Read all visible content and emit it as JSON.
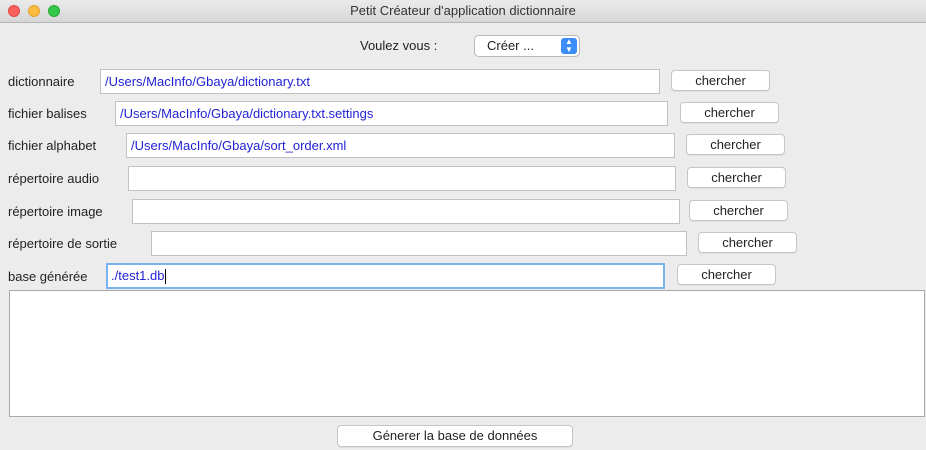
{
  "window": {
    "title": "Petit Créateur d'application dictionnaire"
  },
  "mode": {
    "label": "Voulez vous :",
    "selected": "Créer ..."
  },
  "rows": [
    {
      "label": "dictionnaire",
      "value": "/Users/MacInfo/Gbaya/dictionary.txt",
      "button": "chercher"
    },
    {
      "label": "fichier balises",
      "value": "/Users/MacInfo/Gbaya/dictionary.txt.settings",
      "button": "chercher"
    },
    {
      "label": "fichier alphabet",
      "value": "/Users/MacInfo/Gbaya/sort_order.xml",
      "button": "chercher"
    },
    {
      "label": "répertoire audio",
      "value": "",
      "button": "chercher"
    },
    {
      "label": "répertoire image",
      "value": "",
      "button": "chercher"
    },
    {
      "label": "répertoire de sortie",
      "value": "",
      "button": "chercher"
    },
    {
      "label": "base générée",
      "value": "./test1.db",
      "button": "chercher"
    }
  ],
  "output": {
    "text": ""
  },
  "actions": {
    "generate_label": "Génerer la base de données"
  },
  "colors": {
    "field_text": "#1f1fd6",
    "focus_ring": "#7ab1ef",
    "select_arrow": "#3b8ef7"
  }
}
